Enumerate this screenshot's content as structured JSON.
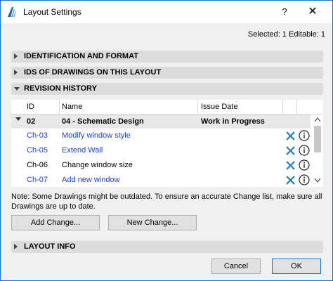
{
  "window": {
    "title": "Layout Settings",
    "help_label": "?",
    "close_label": "✕"
  },
  "selected_info": "Selected: 1 Editable: 1",
  "sections": {
    "identification": "IDENTIFICATION AND FORMAT",
    "ids_of_drawings": "IDS OF DRAWINGS ON THIS LAYOUT",
    "revision_history": "REVISION HISTORY",
    "layout_info": "LAYOUT INFO"
  },
  "table": {
    "headers": {
      "id": "ID",
      "name": "Name",
      "issue_date": "Issue Date"
    },
    "group": {
      "id": "02",
      "name": "04 - Schematic Design",
      "issue_date": "Work in Progress"
    },
    "rows": [
      {
        "id": "Ch-03",
        "name": "Modify window style"
      },
      {
        "id": "Ch-05",
        "name": "Extend Wall"
      },
      {
        "id": "Ch-06",
        "name": "Change window size"
      },
      {
        "id": "Ch-07",
        "name": "Add new window"
      }
    ]
  },
  "note": "Note: Some Drawings might be outdated. To ensure an accurate Change list, make sure all Drawings are up to date.",
  "buttons": {
    "add_change": "Add Change...",
    "new_change": "New Change...",
    "cancel": "Cancel",
    "ok": "OK"
  },
  "colors": {
    "link": "#1a3ed6",
    "delete_icon": "#1a73c9",
    "window_border": "#1a73c9"
  },
  "icons": {
    "app": "archicad-icon",
    "delete": "delete-x-icon",
    "info": "info-icon"
  }
}
